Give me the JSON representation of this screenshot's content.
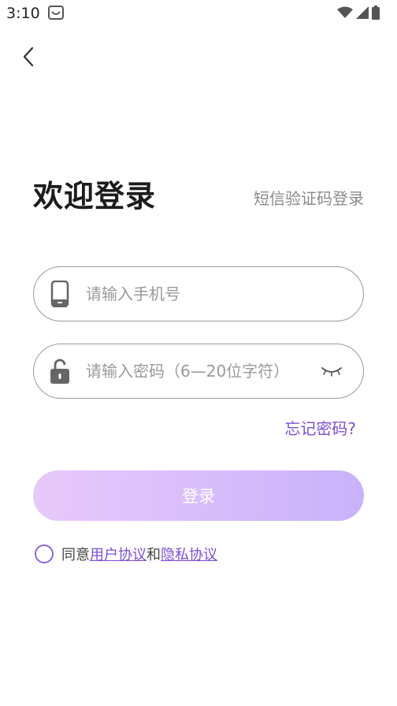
{
  "status_bar": {
    "time": "3:10"
  },
  "header": {
    "title": "欢迎登录",
    "sms_login": "短信验证码登录"
  },
  "form": {
    "phone_placeholder": "请输入手机号",
    "password_placeholder": "请输入密码（6—20位字符）",
    "forgot_password": "忘记密码?",
    "login_label": "登录"
  },
  "agreement": {
    "prefix": "同意",
    "user_agreement": "用户协议",
    "conjunction": "和",
    "privacy_agreement": "隐私协议"
  },
  "colors": {
    "accent": "#7b4fd6",
    "button_gradient_start": "#e8c9fb",
    "button_gradient_end": "#c9b2fb"
  },
  "icons": {
    "back": "chevron-left-icon",
    "phone": "phone-icon",
    "lock": "lock-icon",
    "eye": "eye-closed-icon"
  }
}
